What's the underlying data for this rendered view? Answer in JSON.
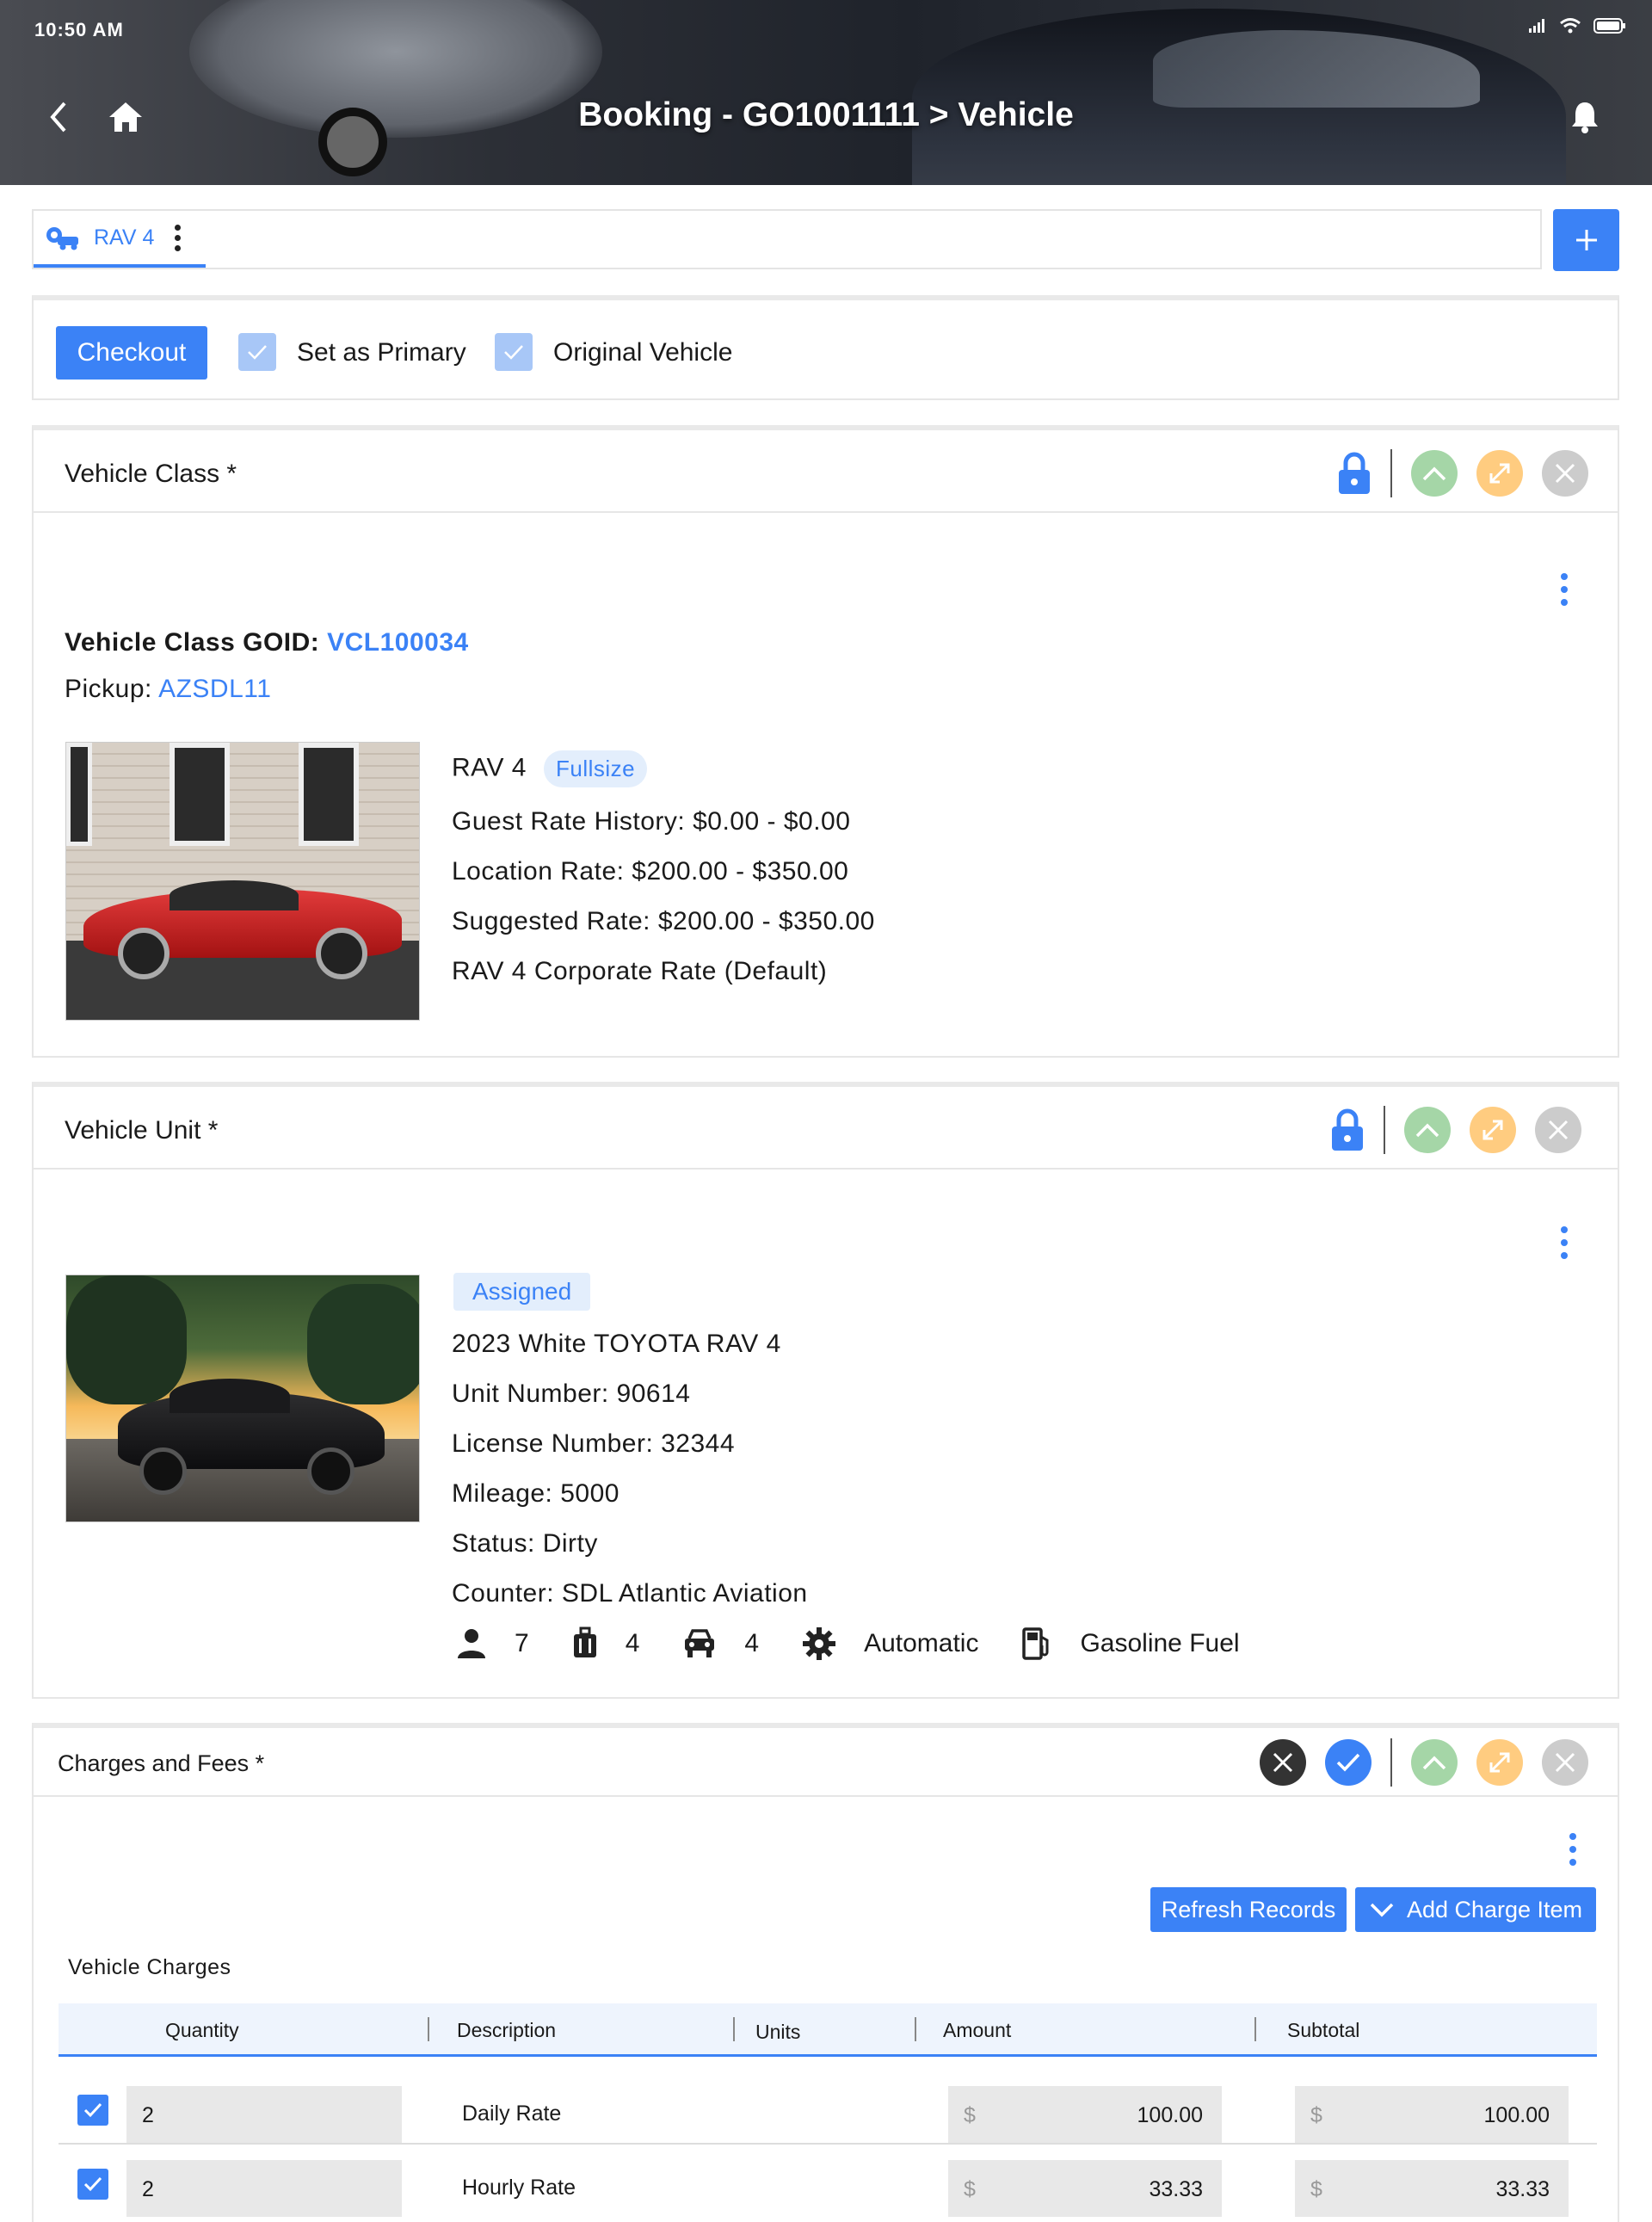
{
  "status_bar": {
    "time": "10:50 AM"
  },
  "header": {
    "title": "Booking - GO1001111 > Vehicle"
  },
  "tabs": [
    {
      "label": "RAV 4"
    }
  ],
  "actions": {
    "checkout_label": "Checkout",
    "set_primary_label": "Set as Primary",
    "original_vehicle_label": "Original Vehicle"
  },
  "vehicle_class": {
    "title": "Vehicle Class *",
    "goid_label": "Vehicle Class GOID: ",
    "goid_value": "VCL100034",
    "pickup_label": "Pickup: ",
    "pickup_value": "AZSDL11",
    "name": "RAV 4",
    "size_badge": "Fullsize",
    "guest_rate": "Guest Rate History: $0.00 - $0.00",
    "location_rate": "Location Rate: $200.00 - $350.00",
    "suggested_rate": "Suggested Rate: $200.00 - $350.00",
    "corporate_rate": "RAV 4 Corporate Rate (Default)"
  },
  "vehicle_unit": {
    "title": "Vehicle Unit *",
    "status_badge": "Assigned",
    "description": "2023 White TOYOTA RAV 4",
    "unit_number": "Unit Number: 90614",
    "license_number": "License Number: 32344",
    "mileage": "Mileage: 5000",
    "status": "Status: Dirty",
    "counter": "Counter: SDL Atlantic Aviation",
    "specs": {
      "passengers": "7",
      "bags": "4",
      "doors": "4",
      "transmission": "Automatic",
      "fuel": "Gasoline Fuel"
    }
  },
  "charges": {
    "title": "Charges and Fees *",
    "refresh_label": "Refresh Records",
    "add_label": "Add Charge Item",
    "section_label": "Vehicle Charges",
    "columns": [
      "Quantity",
      "Description",
      "Units",
      "Amount",
      "Subtotal"
    ],
    "currency": "$",
    "rows": [
      {
        "quantity": "2",
        "description": "Daily Rate",
        "amount": "100.00",
        "subtotal": "100.00"
      },
      {
        "quantity": "2",
        "description": "Hourly Rate",
        "amount": "33.33",
        "subtotal": "33.33"
      }
    ]
  },
  "colors": {
    "accent": "#3b82f6",
    "green": "#a5d6a7",
    "orange": "#ffcc80",
    "gray": "#cccccc"
  }
}
